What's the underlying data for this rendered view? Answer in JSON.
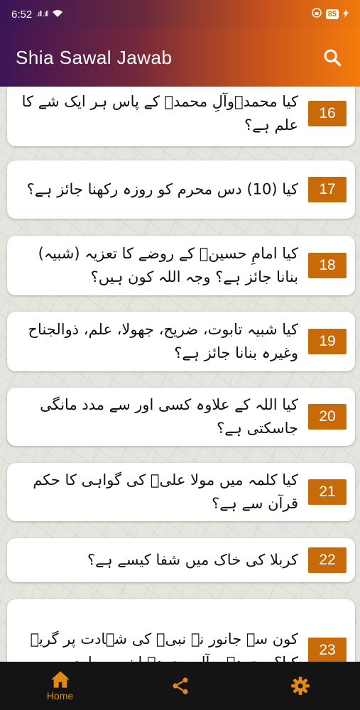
{
  "status_bar": {
    "time": "6:52",
    "signal_text": ".ıll .ıll",
    "battery": "85"
  },
  "app_bar": {
    "title": "Shia Sawal Jawab"
  },
  "questions": [
    {
      "number": "16",
      "text": "کیا محمدؐوآلِ محمدؐ کے پاس ہر ایک شے کا علم ہے؟"
    },
    {
      "number": "17",
      "text": "کیا (10) دس محرم کو روزہ رکھنا جائز ہے؟"
    },
    {
      "number": "18",
      "text": "کیا امامِ حسینؑ کے روضے کا تعزیہ (شبیہ) بنانا جائز ہے؟ وجہ اللہ کون ہیں؟"
    },
    {
      "number": "19",
      "text": "کیا شبیہ تابوت، ضریح، جھولا، علم، ذوالجناح وغیرہ بنانا جائز ہے؟"
    },
    {
      "number": "20",
      "text": "کیا اللہ کے علاوہ کسی اور سے مدد مانگی جاسکتی ہے؟"
    },
    {
      "number": "21",
      "text": "کیا کلمہ میں مولا علیؑ کی گواہی کا حکم قرآن سے ہے؟"
    },
    {
      "number": "22",
      "text": "کربلا کی خاک میں شفا کیسے ہے؟"
    },
    {
      "number": "23",
      "text": "کون سے جانور نے نبیؐ کی شہادت پر گریہ کیا؟ محمدؐ و آل محمدؐ اپنی سواری"
    }
  ],
  "bottom_nav": {
    "home_label": "Home"
  },
  "colors": {
    "accent": "#c96a08",
    "nav_icon": "#e18a14",
    "nav_bg": "#141414"
  }
}
